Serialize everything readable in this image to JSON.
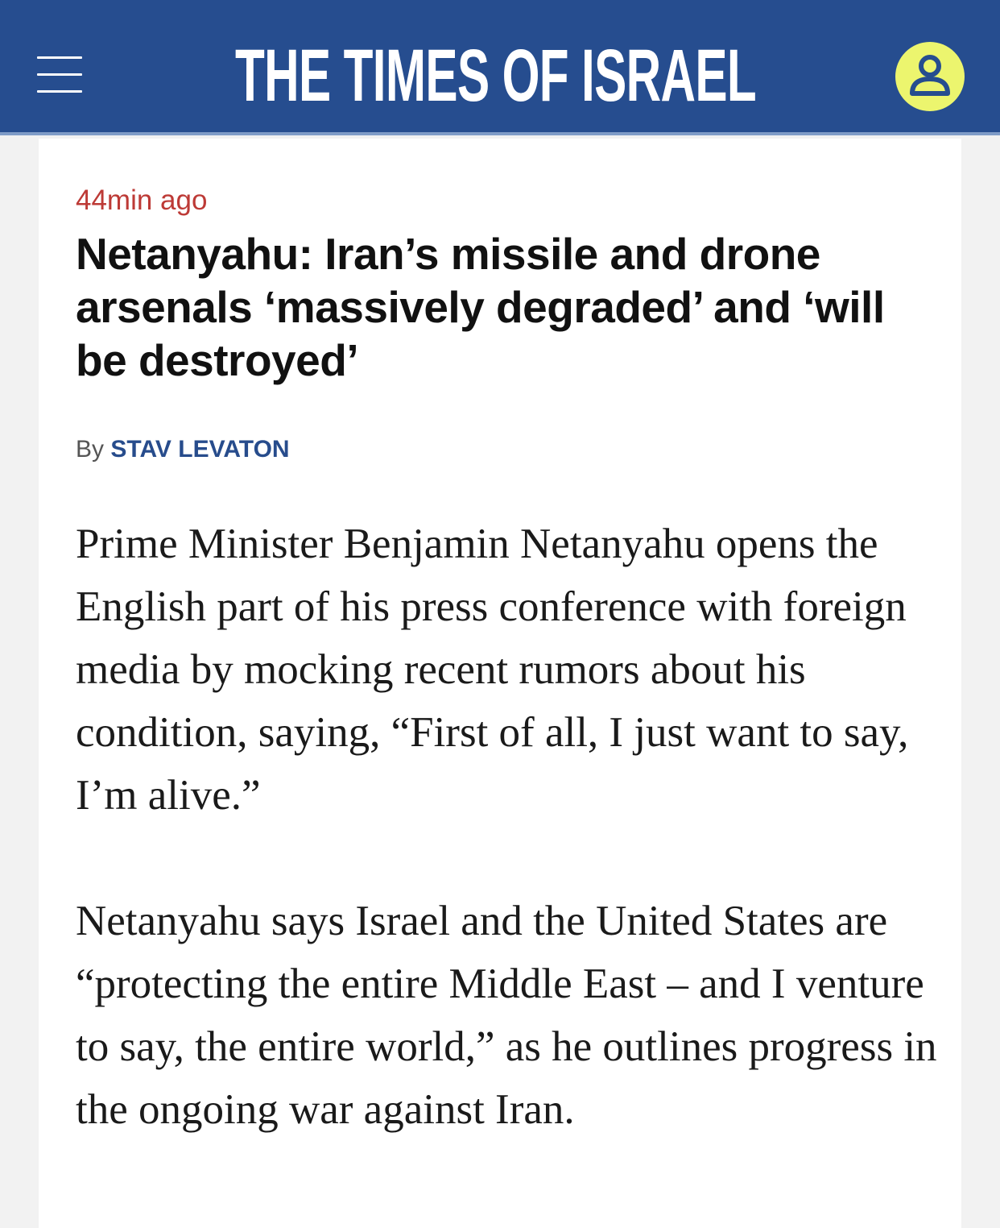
{
  "header": {
    "logo_text": "THE TIMES OF ISRAEL",
    "brand_color": "#264d8f",
    "avatar_color": "#ecf56e",
    "menu_icon": "hamburger-menu-icon",
    "account_icon": "user-account-icon"
  },
  "article": {
    "timestamp": "44min ago",
    "headline": "Netanyahu: Iran’s missile and drone arsenals ‘massively degraded’ and ‘will be destroyed’",
    "byline_prefix": "By",
    "author": "STAV LEVATON",
    "paragraphs": [
      "Prime Minister Benjamin Netanyahu opens the English part of his press conference with foreign media by mocking recent rumors about his condition, saying, “First of all, I just want to say, I’m alive.”",
      "Netanyahu says Israel and the United States are “protecting the entire Middle East – and I venture to say, the entire world,” as he outlines progress in the ongoing war against Iran."
    ]
  }
}
